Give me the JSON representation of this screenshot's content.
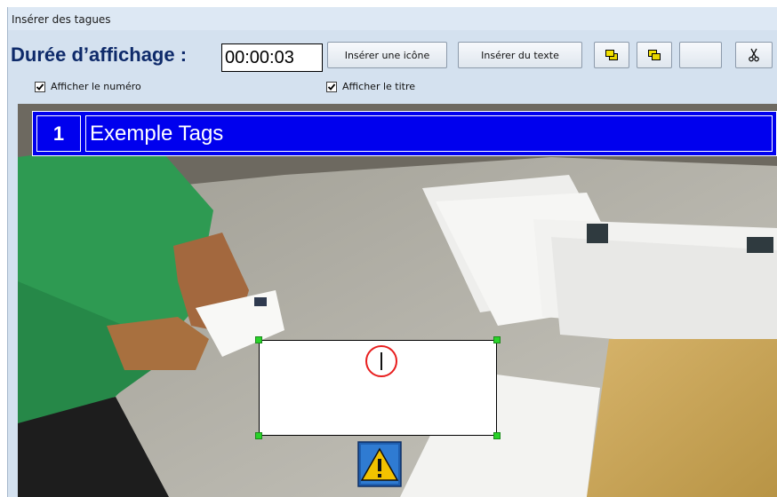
{
  "window": {
    "title": "Insérer des tagues"
  },
  "toolbar": {
    "duration_label": "Durée d’affichage :",
    "duration_value": "00:00:03",
    "insert_icon_label": "Insérer une icône",
    "insert_text_label": "Insérer du texte",
    "bring_front_icon": "bring-to-front-icon",
    "send_back_icon": "send-to-back-icon",
    "cut_icon": "scissors-icon"
  },
  "options": {
    "show_number": {
      "label": "Afficher le numéro",
      "checked": true
    },
    "show_title": {
      "label": "Afficher le titre",
      "checked": true
    }
  },
  "overlay": {
    "tag_number": "1",
    "tag_title": "Exemple Tags",
    "header_color": "#0000EE",
    "warning_icon": "warning-icon"
  },
  "colors": {
    "window_bg": "#D4E1EF",
    "label_color": "#0E2A6A",
    "handle_color": "#29D229",
    "cursor_ring": "#E81E1E"
  }
}
